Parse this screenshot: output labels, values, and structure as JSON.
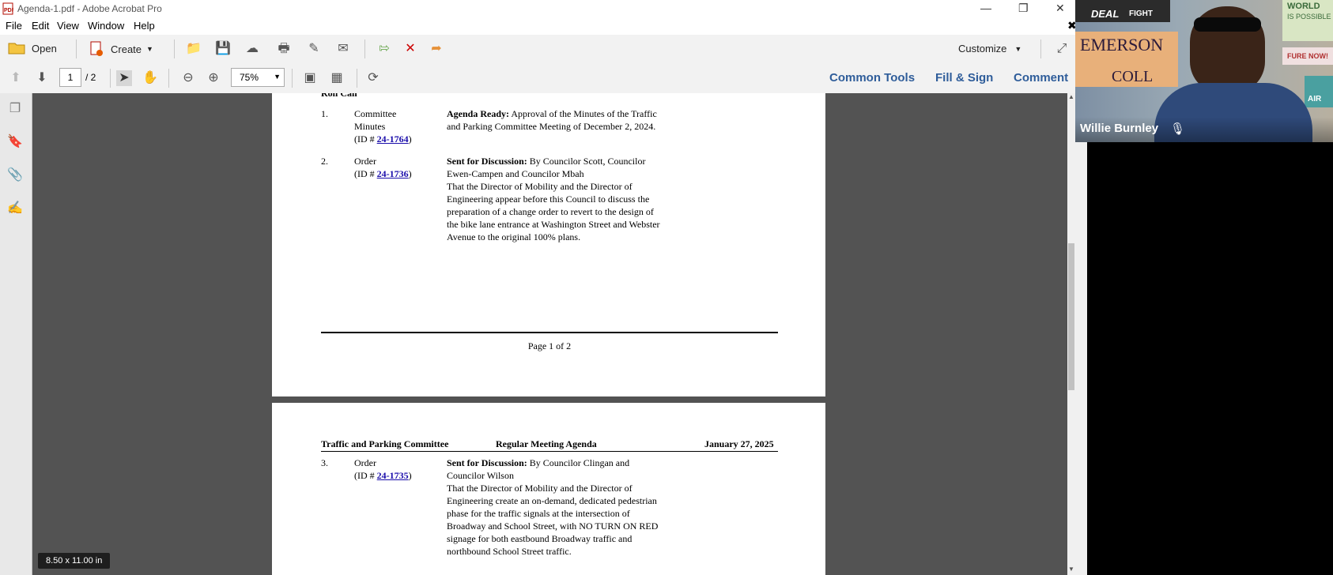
{
  "window": {
    "title": "Agenda-1.pdf - Adobe Acrobat Pro"
  },
  "menu": {
    "items": [
      "File",
      "Edit",
      "View",
      "Window",
      "Help"
    ]
  },
  "toolbar": {
    "open_label": "Open",
    "create_label": "Create",
    "customize_label": "Customize"
  },
  "nav": {
    "current_page": "1",
    "total_pages": "/ 2",
    "zoom": "75%"
  },
  "tabs": {
    "common_tools": "Common Tools",
    "fill_sign": "Fill & Sign",
    "comment": "Comment"
  },
  "page1": {
    "roll_call": "Roll Call",
    "item1": {
      "num": "1.",
      "type_line1": "Committee",
      "type_line2": "Minutes",
      "id_prefix": "(ID # ",
      "id": "24-1764",
      "id_suffix": ")",
      "status": "Agenda Ready:",
      "line1": " Approval of the Minutes of the Traffic",
      "line2": "and Parking Committee Meeting of December 2, 2024."
    },
    "item2": {
      "num": "2.",
      "type": "Order",
      "id_prefix": "(ID # ",
      "id": "24-1736",
      "id_suffix": ")",
      "status": "Sent for Discussion:",
      "line1": " By Councilor Scott, Councilor",
      "line2": "Ewen-Campen and Councilor Mbah",
      "line3": "That the Director of Mobility and the Director of",
      "line4": "Engineering appear before this Council to discuss the",
      "line5": "preparation of a change order to revert to the design of",
      "line6": "the bike lane entrance at Washington Street and Webster",
      "line7": "Avenue to the original 100% plans."
    },
    "footer": "Page 1 of 2"
  },
  "page2": {
    "header_left": "Traffic and Parking Committee",
    "header_center": "Regular Meeting Agenda",
    "header_right": "January 27, 2025",
    "item3": {
      "num": "3.",
      "type": "Order",
      "id_prefix": "(ID # ",
      "id": "24-1735",
      "id_suffix": ")",
      "status": "Sent for Discussion:",
      "line1": " By Councilor Clingan and",
      "line2": "Councilor Wilson",
      "line3": "That the Director of Mobility and the Director of",
      "line4": "Engineering create an on-demand, dedicated pedestrian",
      "line5": "phase for the traffic signals at the intersection of",
      "line6": "Broadway and School Street, with NO TURN ON RED",
      "line7": "signage for both eastbound Broadway traffic and",
      "line8": "northbound School Street traffic."
    }
  },
  "status": {
    "page_size": "8.50 x 11.00 in"
  },
  "video": {
    "participant_name": "Willie Burnley",
    "poster_text_1": "EMERSON",
    "poster_text_2": "COLL",
    "sticker_1": "DEAL",
    "sticker_2": "FIGHT",
    "sticker_3": "WORLD",
    "sticker_4": "IS POSSIBLE",
    "sticker_5": "FURE NOW!",
    "sticker_6": "AIR"
  },
  "colors": {
    "viewer_bg": "#535353",
    "tab_blue": "#2f5d9a",
    "link_blue": "#1a0dab"
  }
}
